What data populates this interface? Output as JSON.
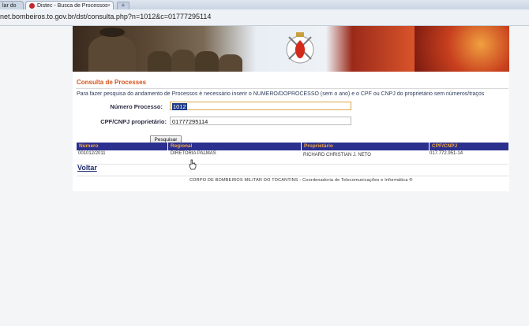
{
  "browser": {
    "tab_prev_label": "lar do",
    "tab_active_label": "Distec - Busca de Processos",
    "tab_close": "×",
    "new_tab": "+",
    "url": "net.bombeiros.to.gov.br/dst/consulta.php?n=1012&c=01777295114"
  },
  "page": {
    "section_title": "Consulta de Processes",
    "instructions": "Para fazer pesquisa do andamento de Processos é necessário inserir o NUMERO/DOPROCESSO (sem o ano) e o CPF ou CNPJ do proprietário sem números/traços",
    "form": {
      "numero_label": "Número Processo:",
      "numero_value": "1012",
      "cpf_label": "CPF/CNPJ proprietário:",
      "cpf_value": "01777295114",
      "search_button": "Pesquisar"
    },
    "table": {
      "headers": [
        "Número",
        "Regional",
        "Proprietário",
        "CPF/CNPJ"
      ],
      "row": [
        "001012/2011",
        "DIRETORIA PALMAS",
        "RICHARD CHRISTIAN J. NETO",
        "017.772.951-14"
      ]
    },
    "back_link": "Voltar",
    "footer": "CORPO DE BOMBEIROS MILITAR DO TOCANTINS - Coordenadoria de Telecomunicações e Informática ®"
  },
  "colors": {
    "table_header_bg": "#2b2f8e",
    "table_header_text": "#f0a640",
    "section_title": "#d4551e"
  }
}
